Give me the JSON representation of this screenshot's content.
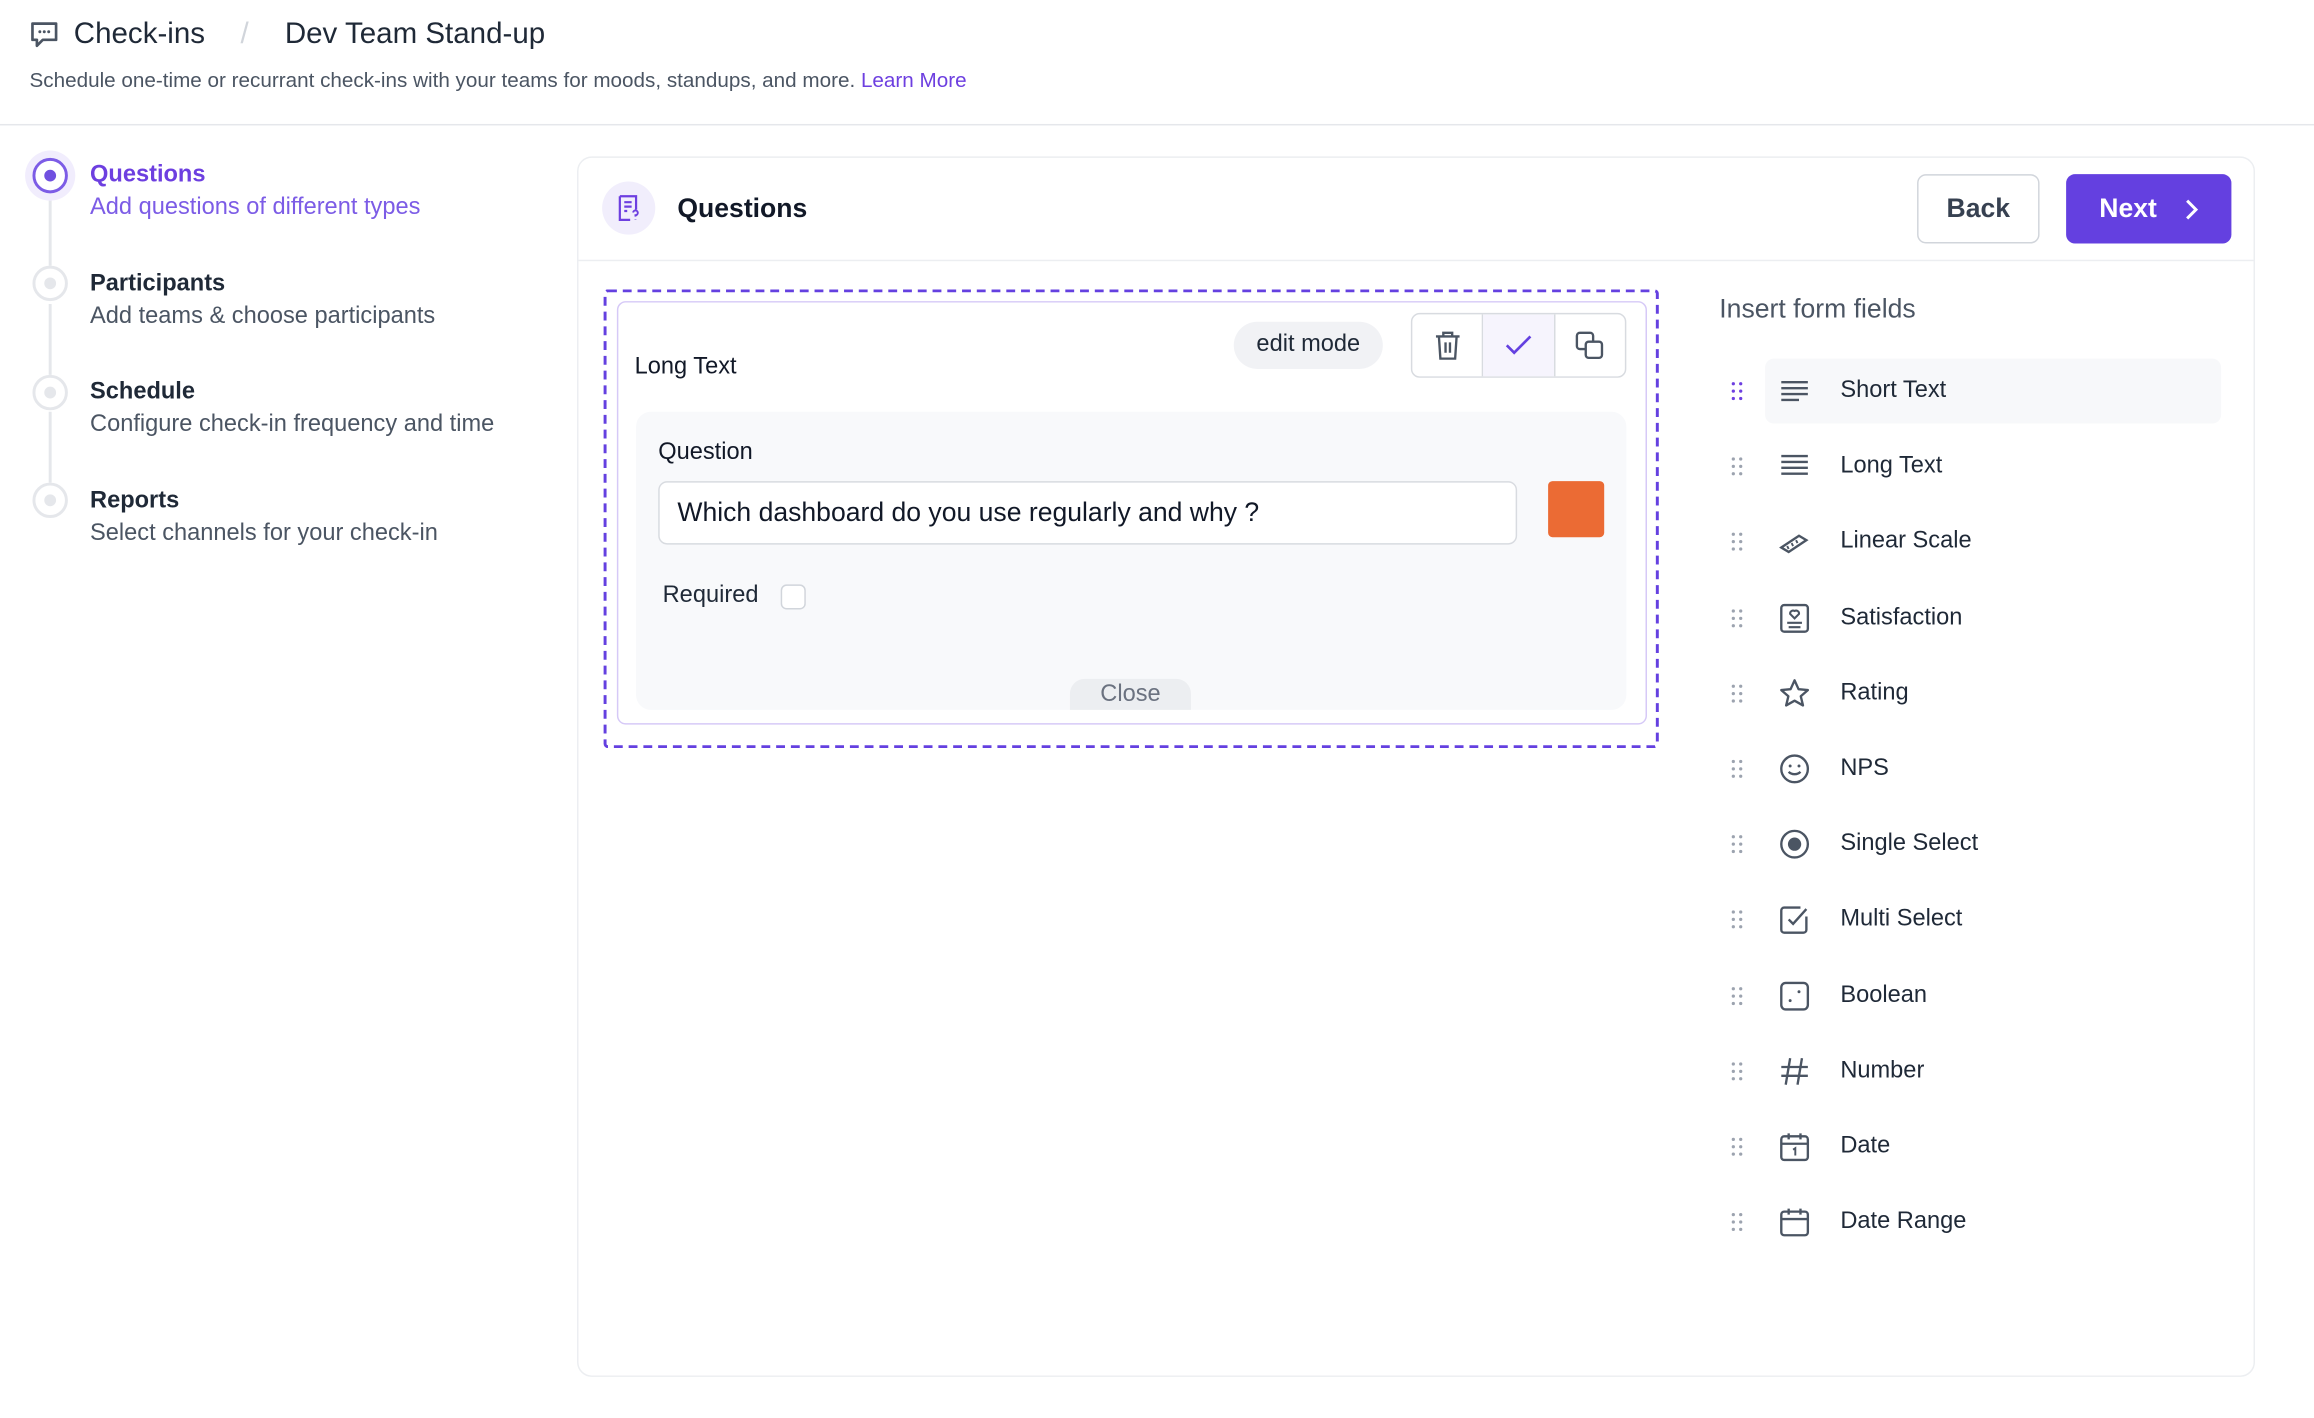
{
  "header": {
    "app_title": "Check-ins",
    "separator": "/",
    "page_title": "Dev Team Stand-up",
    "subtitle": "Schedule one-time or recurrant check-ins with your teams for moods, standups, and more.",
    "learn_more": "Learn More",
    "icon": "chat-bubble-icon"
  },
  "steps": [
    {
      "title": "Questions",
      "desc": "Add questions of different types",
      "active": true
    },
    {
      "title": "Participants",
      "desc": "Add teams & choose participants",
      "active": false
    },
    {
      "title": "Schedule",
      "desc": "Configure check-in frequency and time",
      "active": false
    },
    {
      "title": "Reports",
      "desc": "Select channels for your check-in",
      "active": false
    }
  ],
  "panel": {
    "title": "Questions",
    "back_label": "Back",
    "next_label": "Next",
    "accent": "#6440e0"
  },
  "question_card": {
    "type_label": "Long Text",
    "mode_badge": "edit mode",
    "question_label": "Question",
    "question_value": "Which dashboard do you use regularly and why ?",
    "color_swatch": "#eb6b34",
    "required_label": "Required",
    "required_checked": false,
    "close_label": "Close"
  },
  "insert_fields": {
    "title": "Insert form fields",
    "items": [
      {
        "label": "Short Text",
        "icon": "short-text-icon"
      },
      {
        "label": "Long Text",
        "icon": "long-text-icon"
      },
      {
        "label": "Linear Scale",
        "icon": "ruler-icon"
      },
      {
        "label": "Satisfaction",
        "icon": "satisfaction-icon"
      },
      {
        "label": "Rating",
        "icon": "star-icon"
      },
      {
        "label": "NPS",
        "icon": "smiley-icon"
      },
      {
        "label": "Single Select",
        "icon": "radio-icon"
      },
      {
        "label": "Multi Select",
        "icon": "checkbox-icon"
      },
      {
        "label": "Boolean",
        "icon": "boolean-icon"
      },
      {
        "label": "Number",
        "icon": "hash-icon"
      },
      {
        "label": "Date",
        "icon": "calendar-icon"
      },
      {
        "label": "Date Range",
        "icon": "calendar-range-icon"
      }
    ]
  }
}
